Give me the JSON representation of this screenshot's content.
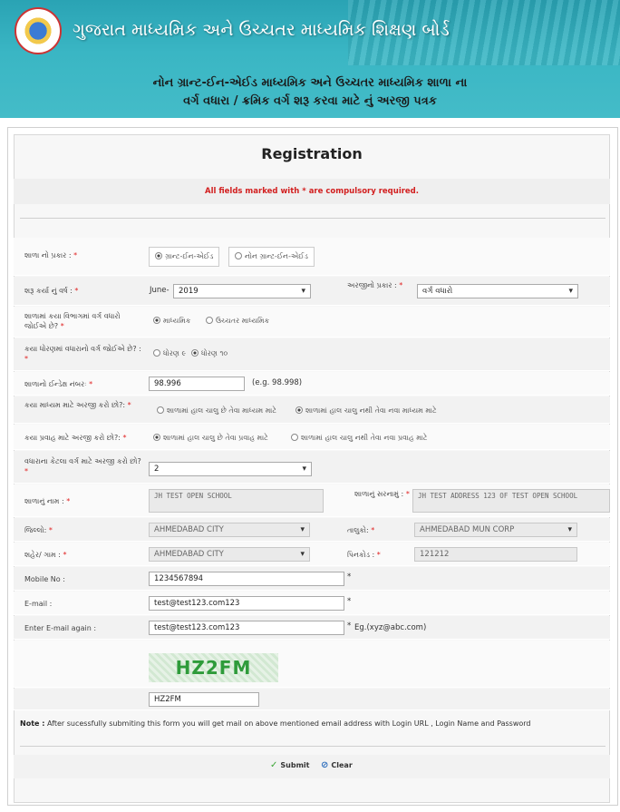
{
  "header": {
    "board_title": "ગુજરાત માધ્યમિક અને ઉચ્ચતર માધ્યમિક શિક્ષણ બોર્ડ",
    "subtitle_line1": "નોન ગ્રાન્ટ-ઈન-એઈડ માધ્યમિક અને ઉચ્ચતર માધ્યમિક શાળા ના",
    "subtitle_line2": "વર્ગ વધારા / ક્રમિક વર્ગ શરૂ કરવા માટે નું અરજી પત્રક"
  },
  "form": {
    "title": "Registration",
    "notice": "All fields marked with * are compulsory required.",
    "required_mark": "*",
    "school_type": {
      "label": "શાળા નો પ્રકાર :",
      "options": [
        "ગ્રાન્ટ-ઈન-એઈડ",
        "નોન ગ્રાન્ટ-ઈન-એઈડ"
      ]
    },
    "start_month_year": {
      "label": "શરૂ કર્યા નું વર્ષ :",
      "month": "June-",
      "year": "2019"
    },
    "application_type": {
      "label": "અરજીનો પ્રકાર :",
      "value": "વર્ગ વધારો"
    },
    "section": {
      "label": "શાળામાં કયા વિભાગમાં વર્ગ વધારો જોઈએ છે?",
      "options": [
        "માધ્યમિક",
        "ઉચ્ચતર માધ્યમિક"
      ]
    },
    "standard": {
      "label": "કયા ધોરણમાં વધારાનો વર્ગ જોઈએ છે? :",
      "options": [
        "ધોરણ ૯",
        "ધોરણ ૧૦"
      ]
    },
    "index_no": {
      "label": "શાળાનો ઈન્ડેક્ષ નંબરઃ",
      "value": "98.996",
      "hint": "(e.g. 98.998)"
    },
    "medium": {
      "label": "કયા માધ્યમ માટે અરજી કરો છો?:",
      "options": [
        "શાળામાં હાલ ચાલુ છે તેવા માધ્યમ માટે",
        "શાળામાં હાલ ચાલુ નથી તેવા નવા માધ્યમ માટે"
      ]
    },
    "stream": {
      "label": "કયા પ્રવાહ માટે અરજી કરો છો?:",
      "options": [
        "શાળામાં હાલ ચાલુ છે તેવા પ્રવાહ માટે",
        "શાળામાં હાલ ચાલુ નથી તેવા નવા પ્રવાહ માટે"
      ]
    },
    "num_classes": {
      "label": "વધારાના કેટલા વર્ગ માટે અરજી કરો છો?",
      "value": "2"
    },
    "school_name": {
      "label": "શાળાનું નામ :",
      "value": "JH TEST OPEN SCHOOL"
    },
    "school_address": {
      "label": "શાળાનું સરનામું :",
      "value": "JH TEST ADDRESS 123 OF TEST OPEN SCHOOL"
    },
    "district": {
      "label": "જિલ્લો:",
      "value": "AHMEDABAD CITY"
    },
    "taluka": {
      "label": "તાલુકો:",
      "value": "AHMEDABAD MUN CORP"
    },
    "city": {
      "label": "શહેર/ ગામ :",
      "value": "AHMEDABAD CITY"
    },
    "pincode": {
      "label": "પિનકોડ :",
      "value": "121212"
    },
    "mobile": {
      "label": "Mobile No :",
      "value": "1234567894"
    },
    "email": {
      "label": "E-mail :",
      "value": "test@test123.com123"
    },
    "email_again": {
      "label": "Enter E-mail again :",
      "value": "test@test123.com123",
      "hint": "Eg.(xyz@abc.com)"
    },
    "captcha": {
      "image_text": "HZ2FM",
      "input_value": "HZ2FM"
    },
    "note_label": "Note :",
    "note_text": "After sucessfully submiting this form you will get mail on above mentioned email address with Login URL , Login Name and Password",
    "submit_label": "Submit",
    "clear_label": "Clear"
  }
}
